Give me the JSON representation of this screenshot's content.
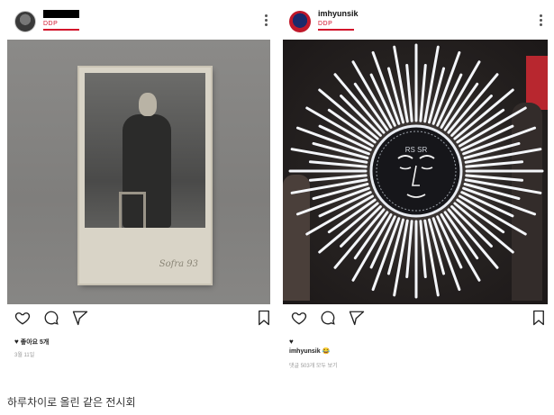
{
  "left_post": {
    "username": "",
    "subline": "DDP",
    "likes_text": "좋아요 5개",
    "date_text": "3월 11일",
    "signature": "Sofra 93"
  },
  "right_post": {
    "username": "imhyunsik",
    "subline": "DDP",
    "caption_user": "imhyunsik",
    "comments_text": "댓글 503개 모두 보기",
    "sculpture_text": "RS SR"
  },
  "page_caption": "하루차이로 올린 같은 전시회",
  "icons": {
    "like": "heart-outline-icon",
    "comment": "comment-bubble-icon",
    "share": "send-paper-plane-icon",
    "save": "bookmark-icon",
    "more": "more-vertical-icon"
  },
  "colors": {
    "brand_red": "#d3122b"
  }
}
